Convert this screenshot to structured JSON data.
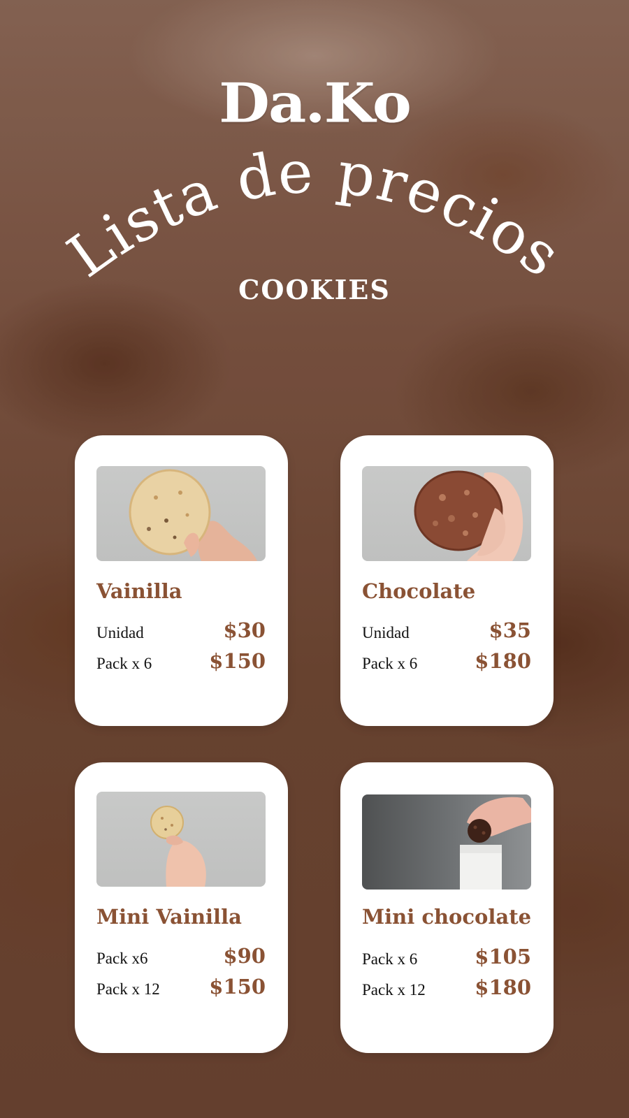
{
  "brand": "Da.Ko",
  "title": "Lista de precios",
  "subtitle": "COOKIES",
  "colors": {
    "accent": "#8a5234",
    "card": "#ffffff",
    "text": "#111111"
  },
  "products": [
    {
      "name": "Vainilla",
      "image": "vanilla-cookie-in-hand",
      "rows": [
        {
          "label": "Unidad",
          "price": "$30"
        },
        {
          "label": "Pack x 6",
          "price": "$150"
        }
      ]
    },
    {
      "name": "Chocolate",
      "image": "chocolate-cookie-in-hand",
      "rows": [
        {
          "label": "Unidad",
          "price": "$35"
        },
        {
          "label": "Pack x 6",
          "price": "$180"
        }
      ]
    },
    {
      "name": "Mini Vainilla",
      "image": "mini-vanilla-cookie-in-hand",
      "rows": [
        {
          "label": "Pack x6",
          "price": "$90"
        },
        {
          "label": "Pack x 12",
          "price": "$150"
        }
      ]
    },
    {
      "name": "Mini chocolate",
      "image": "mini-chocolate-cookie-dunked-in-milk",
      "rows": [
        {
          "label": "Pack x 6",
          "price": "$105"
        },
        {
          "label": "Pack x 12",
          "price": "$180"
        }
      ]
    }
  ]
}
